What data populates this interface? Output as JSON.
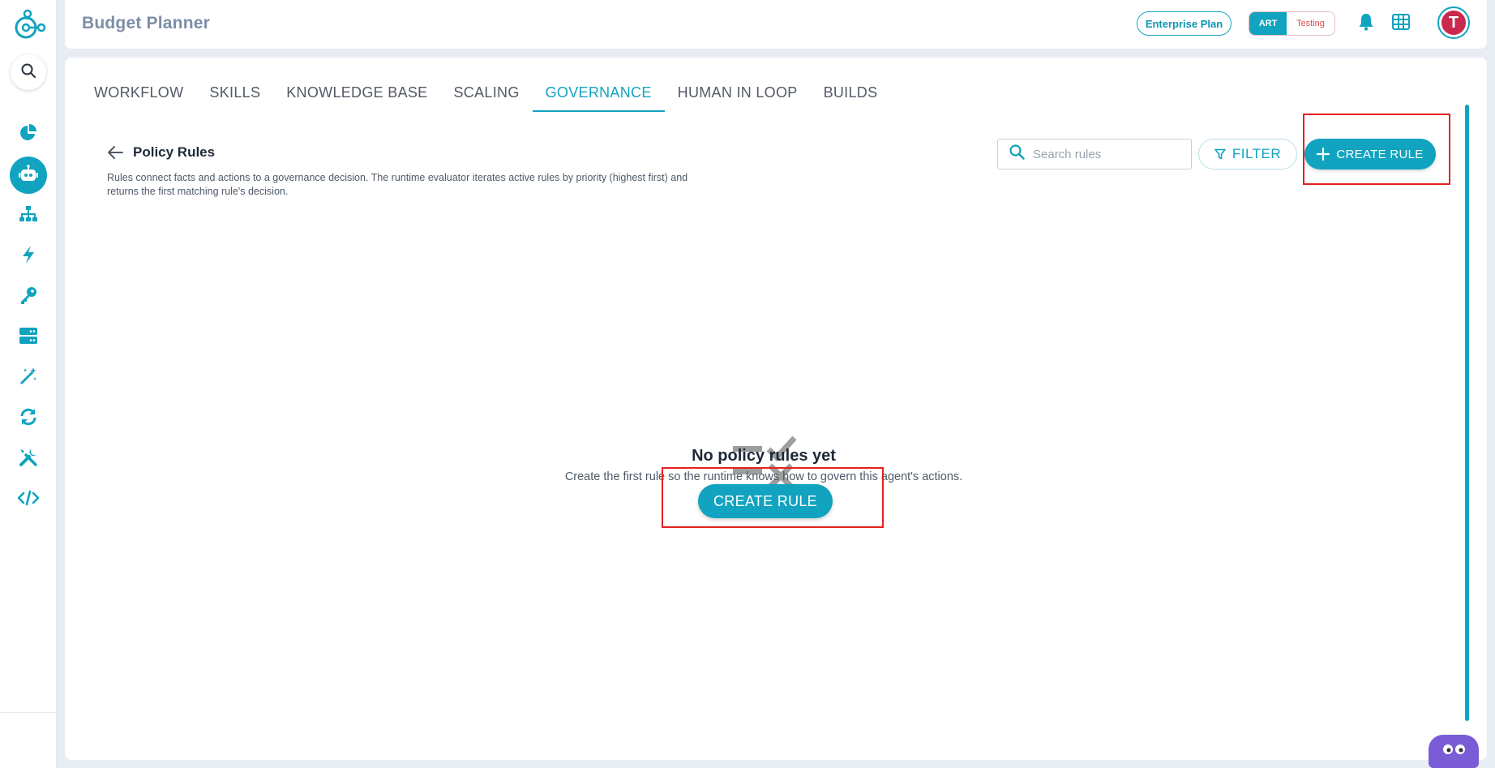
{
  "app": {
    "title": "Budget Planner",
    "plan_label": "Enterprise Plan",
    "env_active": "ART",
    "env_other": "Testing",
    "avatar_initial": "T"
  },
  "sidebar": {
    "items": [
      {
        "icon": "pie-chart-icon"
      },
      {
        "icon": "robot-icon",
        "active": true
      },
      {
        "icon": "sitemap-icon"
      },
      {
        "icon": "lightning-icon"
      },
      {
        "icon": "key-icon"
      },
      {
        "icon": "server-icon"
      },
      {
        "icon": "magic-wand-icon"
      },
      {
        "icon": "sync-icon"
      },
      {
        "icon": "tools-icon"
      },
      {
        "icon": "code-icon"
      }
    ]
  },
  "tabs": [
    {
      "label": "WORKFLOW"
    },
    {
      "label": "SKILLS"
    },
    {
      "label": "KNOWLEDGE BASE"
    },
    {
      "label": "SCALING"
    },
    {
      "label": "GOVERNANCE",
      "active": true
    },
    {
      "label": "HUMAN IN LOOP"
    },
    {
      "label": "BUILDS"
    }
  ],
  "page": {
    "title": "Policy Rules",
    "description": "Rules connect facts and actions to a governance decision. The runtime evaluator iterates active rules by priority (highest first) and returns the first matching rule's decision.",
    "search_placeholder": "Search rules",
    "filter_label": "FILTER",
    "create_label": "CREATE RULE"
  },
  "empty_state": {
    "title": "No policy rules yet",
    "description": "Create the first rule so the runtime knows how to govern this agent's actions.",
    "button_label": "CREATE RULE"
  },
  "colors": {
    "accent": "#11a3bf",
    "highlight": "#e62020",
    "testing": "#e04848"
  }
}
